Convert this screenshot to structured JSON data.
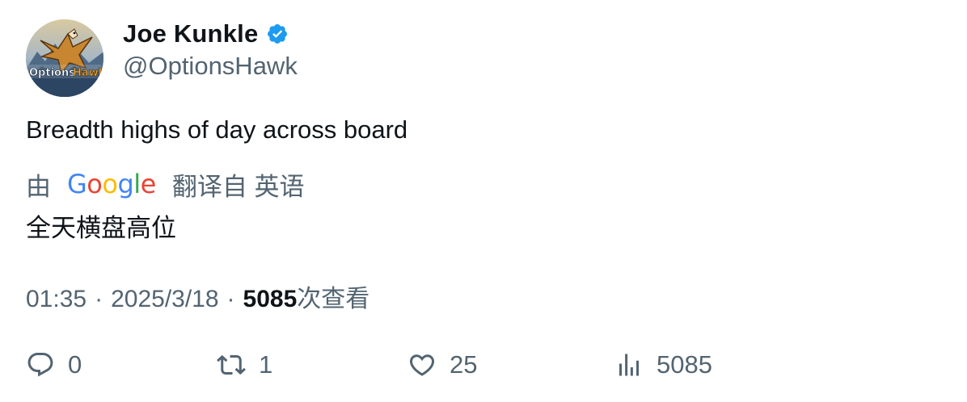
{
  "author": {
    "display_name": "Joe Kunkle",
    "handle": "@OptionsHawk",
    "verified": true,
    "avatar_text": "OptionsHawk"
  },
  "tweet": {
    "text": "Breadth highs of day across board"
  },
  "translation": {
    "prefix": "由",
    "provider": "Google",
    "suffix": "翻译自 英语",
    "text": "全天横盘高位"
  },
  "meta": {
    "time": "01:35",
    "date": "2025/3/18",
    "separator": "·",
    "views_count": "5085",
    "views_label": "次查看"
  },
  "actions": {
    "reply_count": "0",
    "retweet_count": "1",
    "like_count": "25",
    "views_count": "5085"
  },
  "colors": {
    "text_primary": "#0f1419",
    "text_secondary": "#536471",
    "verified_blue": "#1d9bf0"
  }
}
